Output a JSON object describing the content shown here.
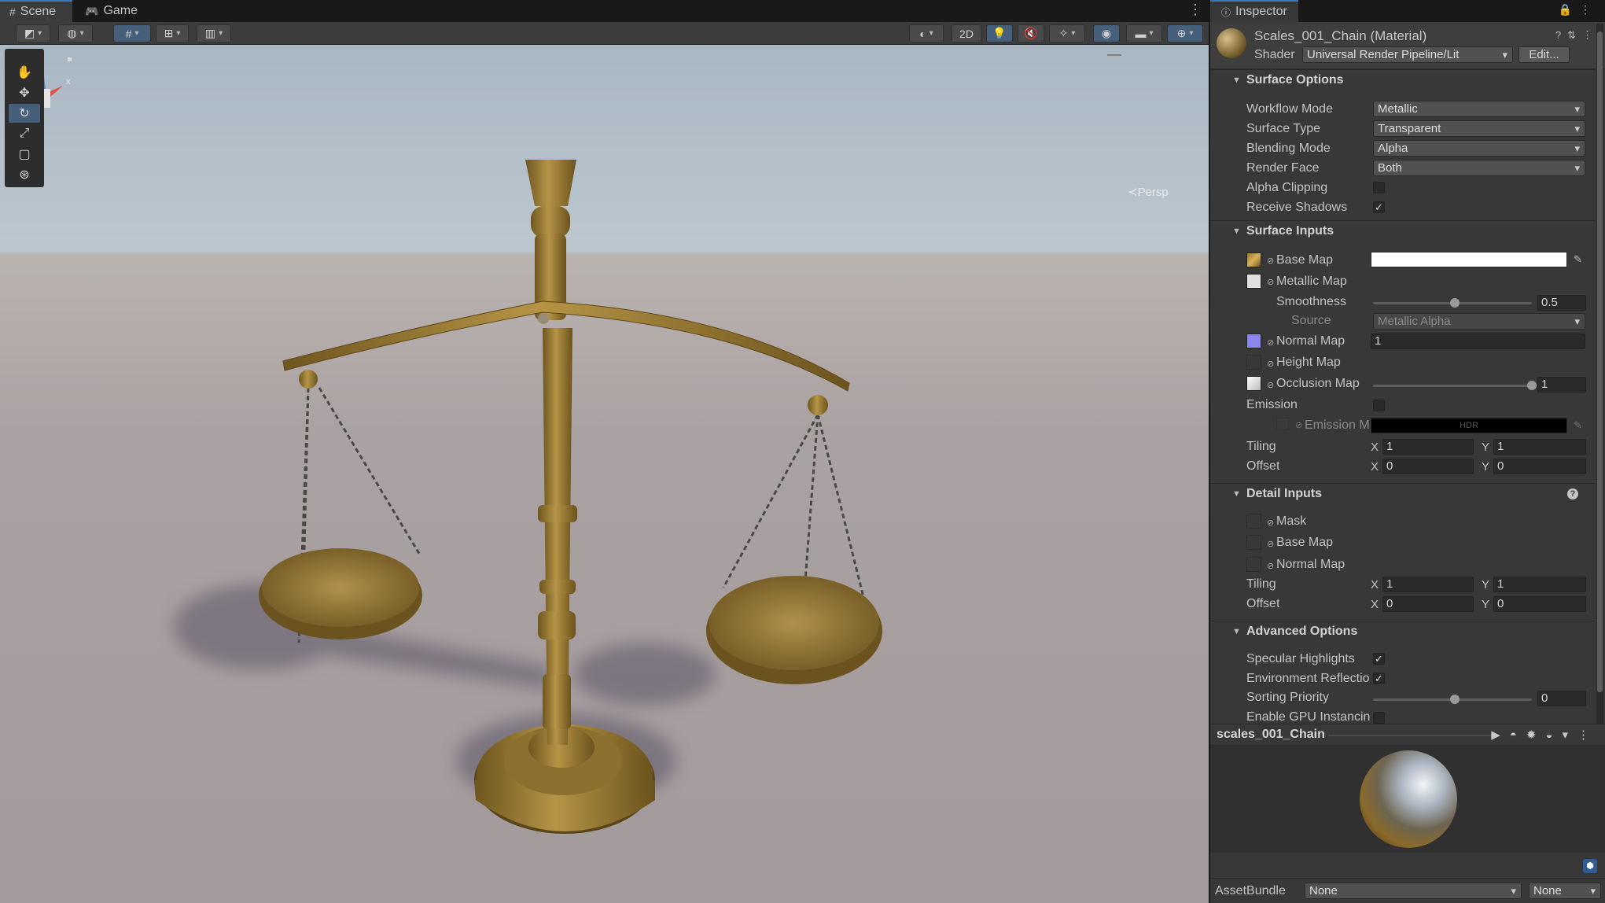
{
  "scene_tabs": [
    {
      "label": "Scene",
      "icon": "grid-icon",
      "active": true
    },
    {
      "label": "Game",
      "icon": "gamepad-icon",
      "active": false
    }
  ],
  "scene_toolbar": {
    "toggle_2d": "2D"
  },
  "scene_view": {
    "projection_label": "≺Persp",
    "gizmo_axis_y": "y",
    "gizmo_axis_x": "x",
    "tools": [
      "hand-tool",
      "move-tool",
      "rotate-tool",
      "scale-tool",
      "rect-tool",
      "transform-tool"
    ],
    "active_tool": "rotate-tool"
  },
  "inspector": {
    "tab_label": "Inspector",
    "material_name": "Scales_001_Chain (Material)",
    "shader_label": "Shader",
    "shader_value": "Universal Render Pipeline/Lit",
    "edit_label": "Edit...",
    "surface_options": {
      "title": "Surface Options",
      "workflow_mode": {
        "label": "Workflow Mode",
        "value": "Metallic"
      },
      "surface_type": {
        "label": "Surface Type",
        "value": "Transparent"
      },
      "blending_mode": {
        "label": "Blending Mode",
        "value": "Alpha"
      },
      "render_face": {
        "label": "Render Face",
        "value": "Both"
      },
      "alpha_clipping": {
        "label": "Alpha Clipping",
        "checked": false
      },
      "receive_shadows": {
        "label": "Receive Shadows",
        "checked": true
      }
    },
    "surface_inputs": {
      "title": "Surface Inputs",
      "base_map": "Base Map",
      "metallic_map": "Metallic Map",
      "smoothness_label": "Smoothness",
      "smoothness_value": "0.5",
      "smoothness_fraction": 0.5,
      "source_label": "Source",
      "source_value": "Metallic Alpha",
      "normal_map": "Normal Map",
      "normal_value": "1",
      "height_map": "Height Map",
      "occlusion_map": "Occlusion Map",
      "occlusion_value": "1",
      "occlusion_fraction": 1.0,
      "emission_label": "Emission",
      "emission_map": "Emission M",
      "emission_hdr": "HDR",
      "tiling_label": "Tiling",
      "offset_label": "Offset",
      "tiling_x": "1",
      "tiling_y": "1",
      "offset_x": "0",
      "offset_y": "0"
    },
    "detail_inputs": {
      "title": "Detail Inputs",
      "mask": "Mask",
      "base_map": "Base Map",
      "normal_map": "Normal Map",
      "tiling_label": "Tiling",
      "offset_label": "Offset",
      "tiling_x": "1",
      "tiling_y": "1",
      "offset_x": "0",
      "offset_y": "0"
    },
    "advanced_options": {
      "title": "Advanced Options",
      "specular_highlights": {
        "label": "Specular Highlights",
        "checked": true
      },
      "environment_reflections": {
        "label": "Environment Reflectio",
        "checked": true
      },
      "sorting_priority_label": "Sorting Priority",
      "sorting_priority_value": "0",
      "sorting_priority_fraction": 0.5,
      "gpu_instancing_label": "Enable GPU Instancin"
    },
    "axis_x": "X",
    "axis_y": "Y",
    "preview_title": "scales_001_Chain",
    "assetbundle_label": "AssetBundle",
    "assetbundle_value": "None",
    "assetbundle_variant": "None"
  },
  "colors": {
    "accent": "#3a79bb",
    "panel": "#383838",
    "brass": "#9a7a35"
  }
}
